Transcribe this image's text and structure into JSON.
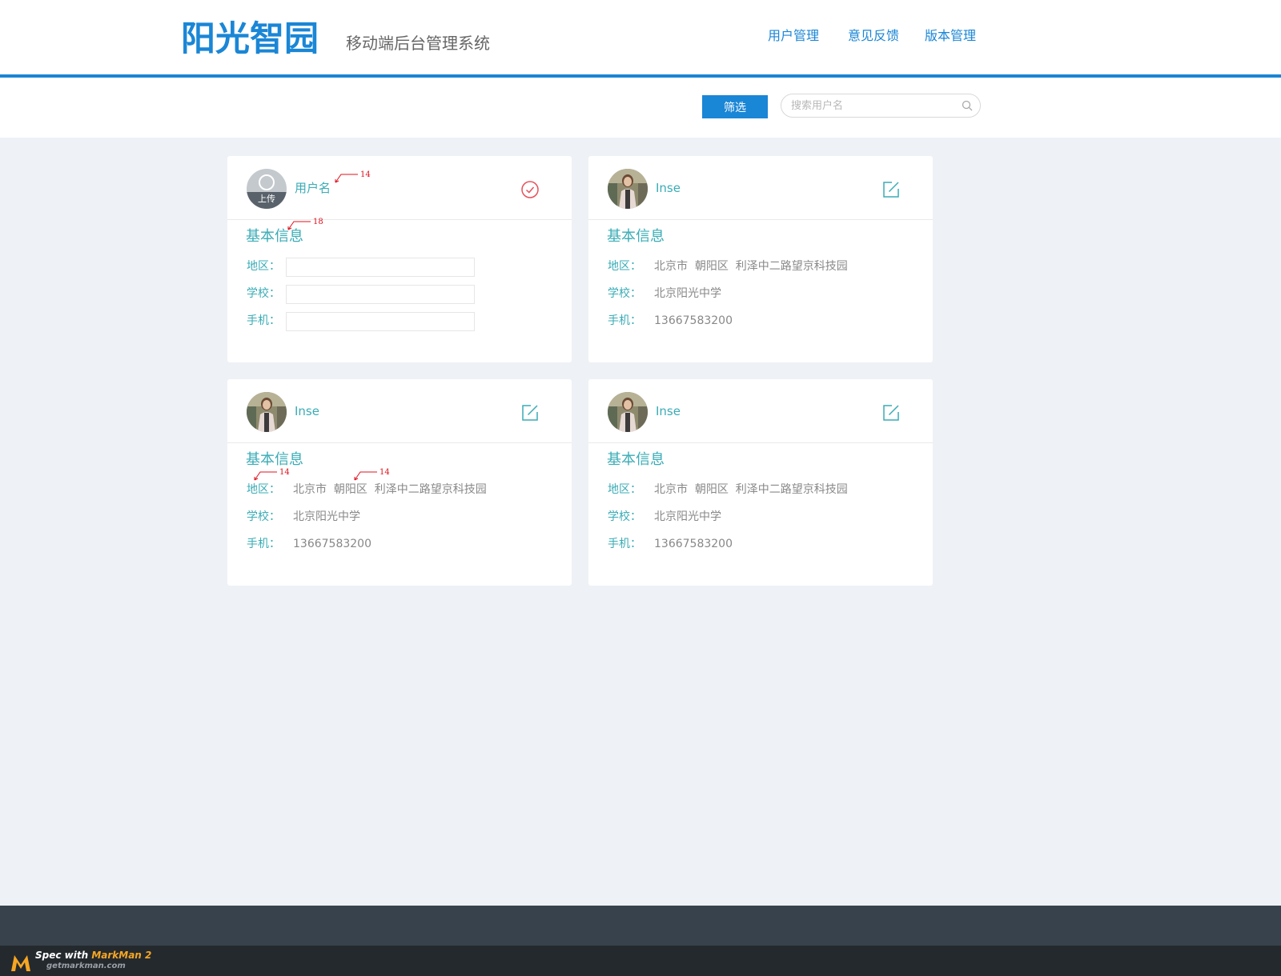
{
  "header": {
    "logo": "阳光智园",
    "subtitle": "移动端后台管理系统",
    "nav": [
      {
        "label": "用户管理"
      },
      {
        "label": "意见反馈"
      },
      {
        "label": "版本管理"
      }
    ]
  },
  "toolbar": {
    "filter_label": "筛选",
    "search_placeholder": "搜索用户名",
    "search_value": ""
  },
  "cards": [
    {
      "mode": "edit",
      "username": "用户名",
      "avatar": "upload",
      "upload_label": "上传",
      "action_icon": "check-circle-icon",
      "section_title": "基本信息",
      "fields": [
        {
          "label": "地区：",
          "value": ""
        },
        {
          "label": "学校：",
          "value": ""
        },
        {
          "label": "手机：",
          "value": ""
        }
      ]
    },
    {
      "mode": "view",
      "username": "Inse",
      "avatar": "photo",
      "action_icon": "edit-icon",
      "section_title": "基本信息",
      "fields": [
        {
          "label": "地区：",
          "value": "北京市  朝阳区  利泽中二路望京科技园"
        },
        {
          "label": "学校：",
          "value": "北京阳光中学"
        },
        {
          "label": "手机：",
          "value": "13667583200"
        }
      ]
    },
    {
      "mode": "view",
      "username": "Inse",
      "avatar": "photo",
      "action_icon": "edit-icon",
      "section_title": "基本信息",
      "fields": [
        {
          "label": "地区：",
          "value": "北京市  朝阳区  利泽中二路望京科技园"
        },
        {
          "label": "学校：",
          "value": "北京阳光中学"
        },
        {
          "label": "手机：",
          "value": "13667583200"
        }
      ]
    },
    {
      "mode": "view",
      "username": "Inse",
      "avatar": "photo",
      "action_icon": "edit-icon",
      "section_title": "基本信息",
      "fields": [
        {
          "label": "地区：",
          "value": "北京市  朝阳区  利泽中二路望京科技园"
        },
        {
          "label": "学校：",
          "value": "北京阳光中学"
        },
        {
          "label": "手机：",
          "value": "13667583200"
        }
      ]
    }
  ],
  "annotations": [
    "14",
    "18",
    "14",
    "14"
  ],
  "watermark": {
    "text_prefix": "Spec with ",
    "brand": "MarkMan 2",
    "url": "getmarkman.com"
  },
  "colors": {
    "primary": "#1a86d6",
    "teal": "#3aacb6",
    "check": "#e8505b",
    "background": "#eef1f5",
    "footer": "#38424c"
  }
}
